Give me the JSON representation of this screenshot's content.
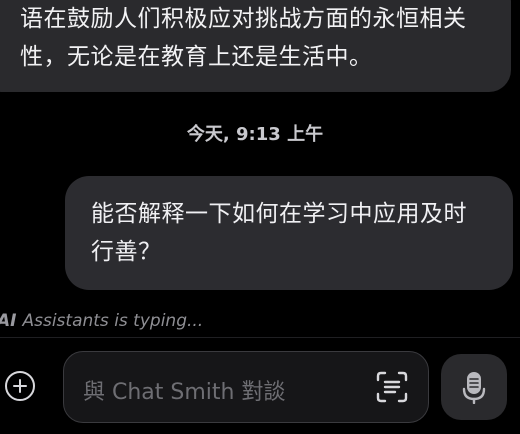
{
  "chat": {
    "incoming_message": {
      "lines": [
        "语在鼓励人们积极应对挑战方面的永恒相关",
        "性，无论是在教育上还是生活中。"
      ]
    },
    "timestamp": "今天, 9:13 上午",
    "outgoing_message": {
      "lines": [
        "能否解释一下如何在学习中应用及时",
        "行善？"
      ]
    },
    "typing_indicator": {
      "ai_mark": "AI",
      "text": "Assistants is typing..."
    }
  },
  "composer": {
    "placeholder": "與 Chat Smith 對談",
    "add_icon": "plus-circle-icon",
    "scan_icon": "text-scan-icon",
    "mic_icon": "microphone-icon"
  },
  "colors": {
    "background": "#000000",
    "bubble": "#2a2a2d",
    "input_border": "#3a3a3e",
    "placeholder": "#6e6e73"
  }
}
